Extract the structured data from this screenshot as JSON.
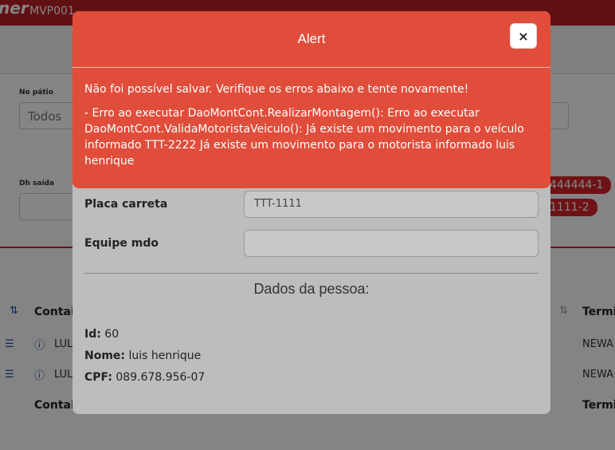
{
  "background": {
    "brand": "ner",
    "code": "MVP001",
    "label_no_patio": "No pátio",
    "select_value": "Todos",
    "label_dh_saida": "Dh saída",
    "badges": [
      "444444-1",
      "1111-2"
    ],
    "col_contai": "Contai",
    "col_termi": "Termi",
    "row1_text": "LUL",
    "row2_text": "LUL",
    "row1_right": "NEWA",
    "row2_right": "NEWA",
    "footer_contai": "Contai",
    "footer_termi": "Termi"
  },
  "modal": {
    "title": "Alert",
    "close_icon": "×",
    "message": "Não foi possível salvar. Verifique os erros abaixo e tente novamente!",
    "detail": "- Erro ao executar DaoMontCont.RealizarMontagem(): Erro ao executar DaoMontCont.ValidaMotoristaVeiculo(): Já existe um movimento para o veículo informado TTT-2222 Já existe um movimento para o motorista informado luis henrique",
    "fields": {
      "placa_carreta_label": "Placa carreta",
      "placa_carreta_value": "TTT-1111",
      "equipe_mdo_label": "Equipe mdo",
      "equipe_mdo_value": ""
    },
    "section_title": "Dados da pessoa:",
    "person": {
      "id_label": "Id:",
      "id_value": "60",
      "name_label": "Nome:",
      "name_value": "luis henrique",
      "cpf_label": "CPF:",
      "cpf_value": "089.678.956-07"
    }
  },
  "colors": {
    "alert_bg": "#e04d3a",
    "brand_red": "#b81f25"
  }
}
